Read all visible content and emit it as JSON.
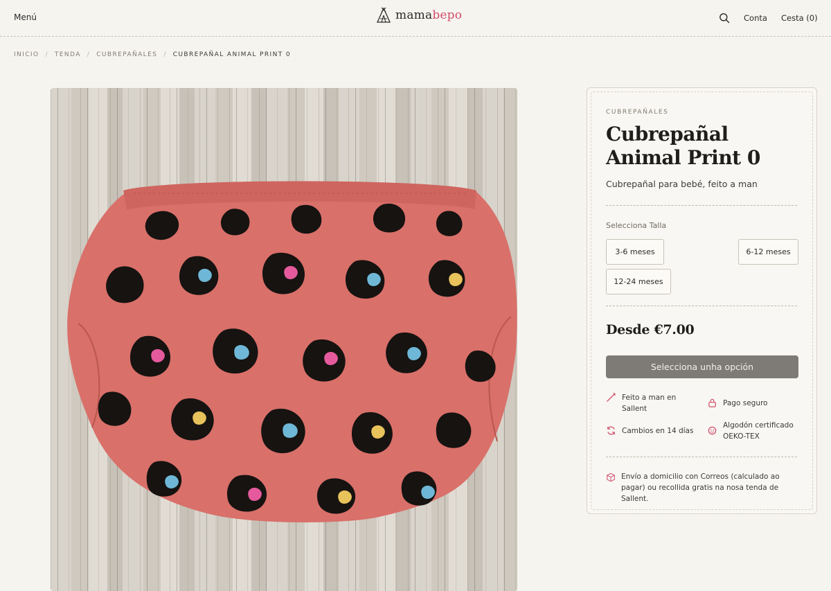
{
  "header": {
    "menu_label": "Menú",
    "logo": {
      "part1": "mama",
      "part2": "bepo"
    },
    "account_label": "Conta",
    "cart_label": "Cesta (0)"
  },
  "breadcrumb": [
    "INICIO",
    "TENDA",
    "CUBREPAÑALES",
    "CUBREPAÑAL ANIMAL PRINT 0"
  ],
  "product": {
    "category": "CUBREPAÑALES",
    "title": "Cubrepañal Animal Print 0",
    "subtitle": "Cubrepañal para bebé, feito a man",
    "size_label": "Selecciona Talla",
    "sizes": [
      "3-6 meses",
      "6-12 meses",
      "12-24 meses"
    ],
    "price": "Desde €7.00",
    "select_button": "Selecciona unha opción",
    "features": [
      {
        "icon": "needle-icon",
        "text": "Feito a man en Sallent"
      },
      {
        "icon": "lock-icon",
        "text": "Pago seguro"
      },
      {
        "icon": "refresh-icon",
        "text": "Cambios en 14 días"
      },
      {
        "icon": "badge-icon",
        "text": "Algodón certificado OEKO-TEX"
      }
    ],
    "shipping": {
      "icon": "box-icon",
      "text": "Envío a domicilio con Correos (calculado ao pagar) ou recollida gratis na nosa tenda de Sallent."
    }
  },
  "colors": {
    "accent": "#d04d6a",
    "button_bg": "#7e7b77",
    "background": "#f8f6f1",
    "diaper_pink": "#d9706a"
  }
}
